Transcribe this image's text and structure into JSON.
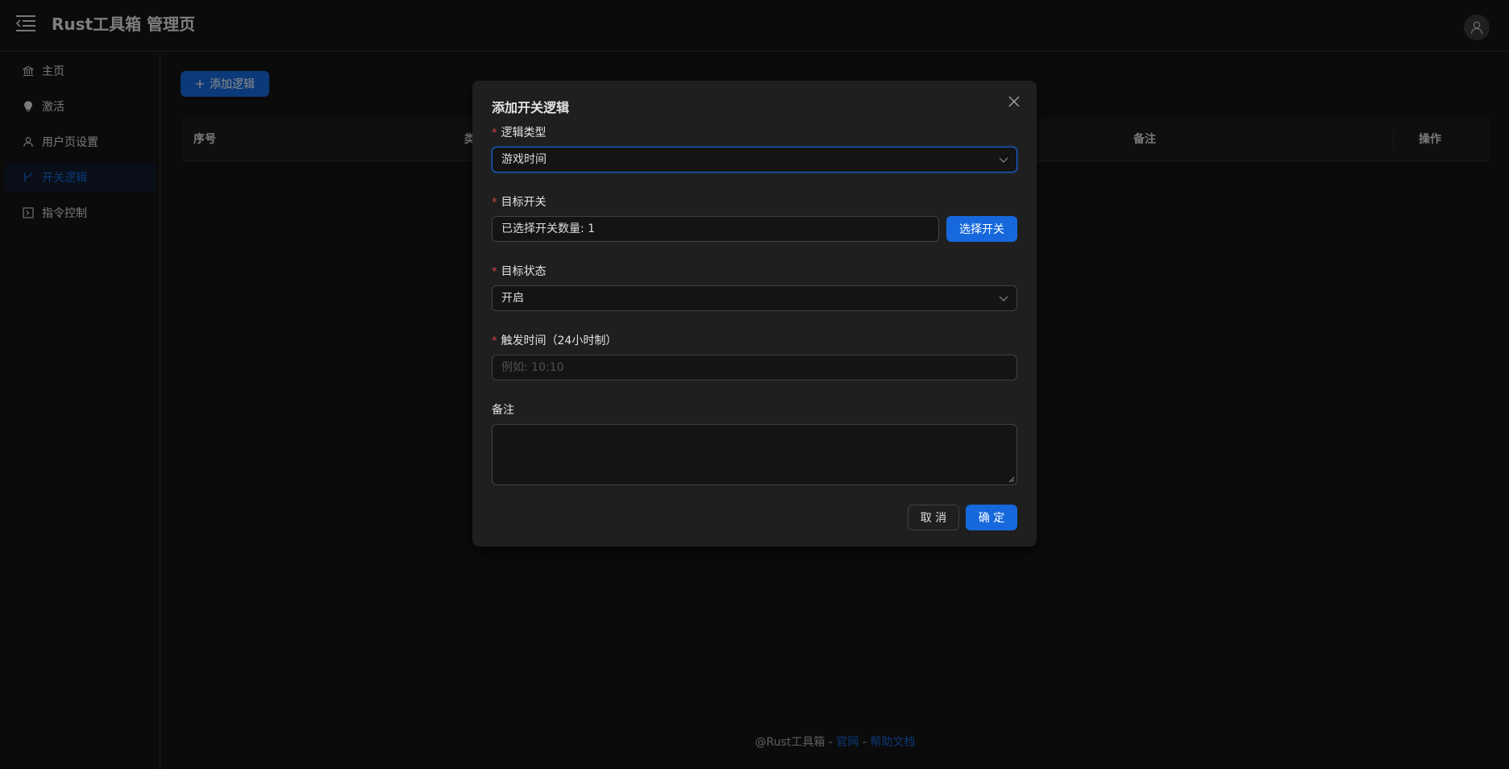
{
  "header": {
    "title": "Rust工具箱 管理页"
  },
  "sidebar": {
    "items": [
      {
        "label": "主页",
        "icon": "bank-icon"
      },
      {
        "label": "激活",
        "icon": "bulb-icon"
      },
      {
        "label": "用户页设置",
        "icon": "user-icon"
      },
      {
        "label": "开关逻辑",
        "icon": "branch-icon",
        "active": true
      },
      {
        "label": "指令控制",
        "icon": "code-icon"
      }
    ]
  },
  "main": {
    "add_button_label": "添加逻辑",
    "table_headers": [
      "序号",
      "类",
      "备注",
      "操作"
    ]
  },
  "footer": {
    "prefix": "@Rust工具箱 - ",
    "link1": "官网",
    "sep": " - ",
    "link2": "帮助文档"
  },
  "modal": {
    "title": "添加开关逻辑",
    "fields": {
      "logic_type": {
        "label": "逻辑类型",
        "value": "游戏时间"
      },
      "target_switch": {
        "label": "目标开关",
        "value": "已选择开关数量: 1",
        "button": "选择开关"
      },
      "target_state": {
        "label": "目标状态",
        "value": "开启"
      },
      "trigger_time": {
        "label": "触发时间（24小时制）",
        "placeholder": "例如: 10:10"
      },
      "remark": {
        "label": "备注"
      }
    },
    "cancel_label": "取 消",
    "ok_label": "确 定"
  },
  "colors": {
    "primary": "#1668dc",
    "required": "#dc4446",
    "background": "#141414",
    "modal": "#1f1f1f"
  }
}
